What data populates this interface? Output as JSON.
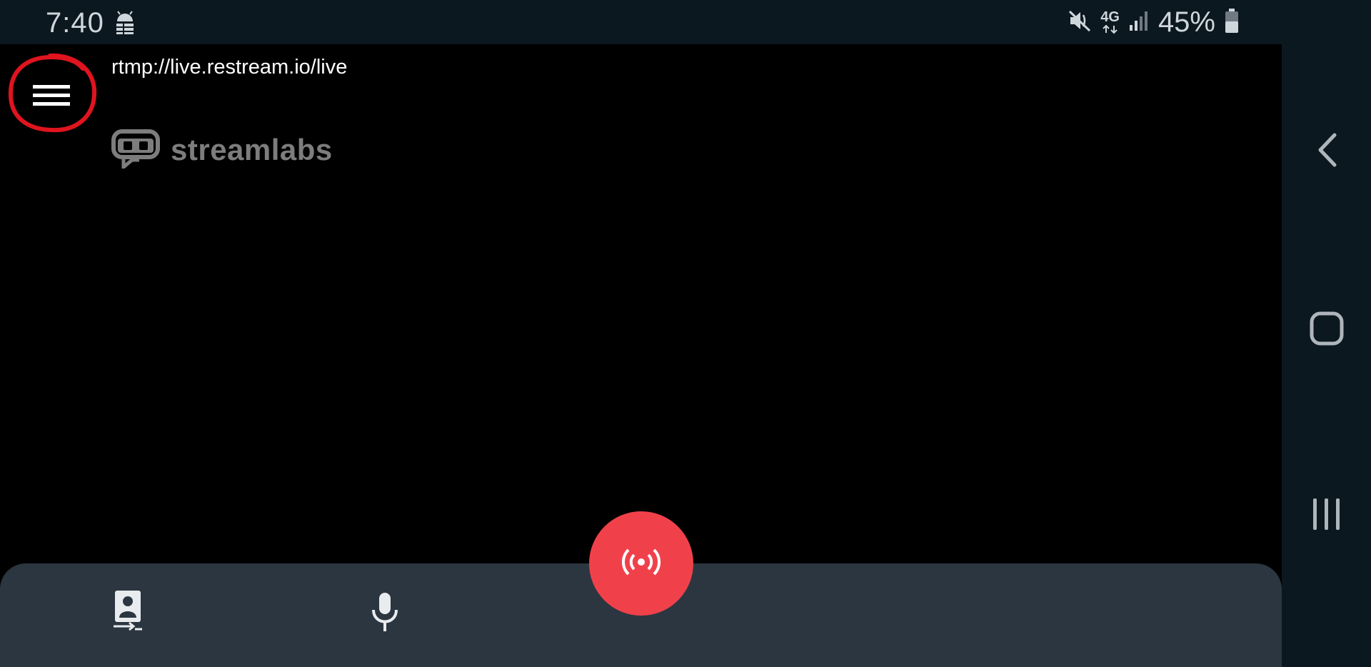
{
  "status_bar": {
    "time": "7:40",
    "network": "4G",
    "battery_percent": "45%",
    "icons": [
      "android-debug-icon",
      "mute-icon",
      "4g-icon",
      "signal-icon",
      "battery-icon"
    ]
  },
  "stream": {
    "server_url": "rtmp://live.restream.io/live"
  },
  "logo": {
    "text": "streamlabs"
  },
  "controls": {
    "icons": [
      "switch-camera-icon",
      "microphone-icon",
      "broadcast-icon"
    ]
  },
  "nav_bar": {
    "icons": [
      "back-icon",
      "home-icon",
      "recents-icon"
    ]
  },
  "colors": {
    "status_bar_bg": "#0c1820",
    "bottom_panel_bg": "#2c3640",
    "go_live": "#f0414b",
    "annotation": "#e0141e",
    "logo_gray": "#7d7d7d"
  }
}
